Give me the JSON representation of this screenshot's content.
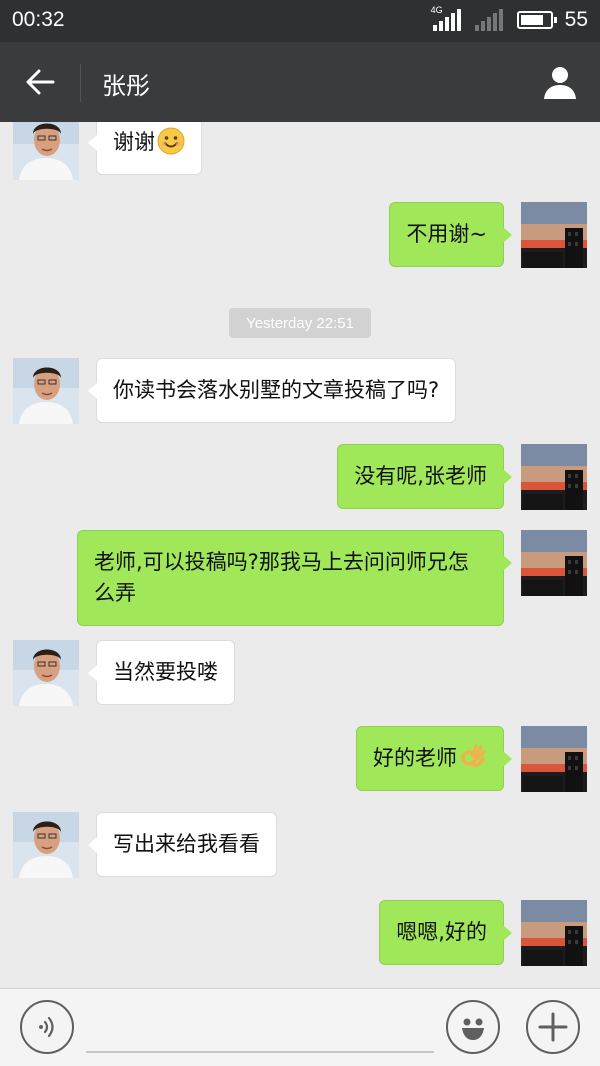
{
  "status": {
    "time": "00:32",
    "network_badge": "4G",
    "battery": "55"
  },
  "header": {
    "back_icon": "back-arrow-icon",
    "title": "张彤",
    "profile_icon": "person-icon"
  },
  "messages": [
    {
      "side": "left",
      "text": "谢谢",
      "emoji": "smile-emoji"
    },
    {
      "side": "right",
      "text": "不用谢~"
    },
    {
      "side": "left",
      "text": "你读书会落水别墅的文章投稿了吗?"
    },
    {
      "side": "right",
      "text": "没有呢,张老师"
    },
    {
      "side": "right",
      "text": "老师,可以投稿吗?那我马上去问问师兄怎么弄"
    },
    {
      "side": "left",
      "text": "当然要投喽"
    },
    {
      "side": "right",
      "text": "好的老师",
      "emoji": "ok-hand-emoji"
    },
    {
      "side": "left",
      "text": "写出来给我看看"
    },
    {
      "side": "right",
      "text": "嗯嗯,好的"
    }
  ],
  "timestamp": "Yesterday 22:51",
  "input_bar": {
    "voice_icon": "voice-icon",
    "emoji_icon": "emoji-icon",
    "plus_icon": "plus-icon"
  },
  "colors": {
    "header_bg": "#3a3b3c",
    "chat_bg": "#ebebeb",
    "sent_bubble": "#a0e75a",
    "received_bubble": "#ffffff"
  }
}
